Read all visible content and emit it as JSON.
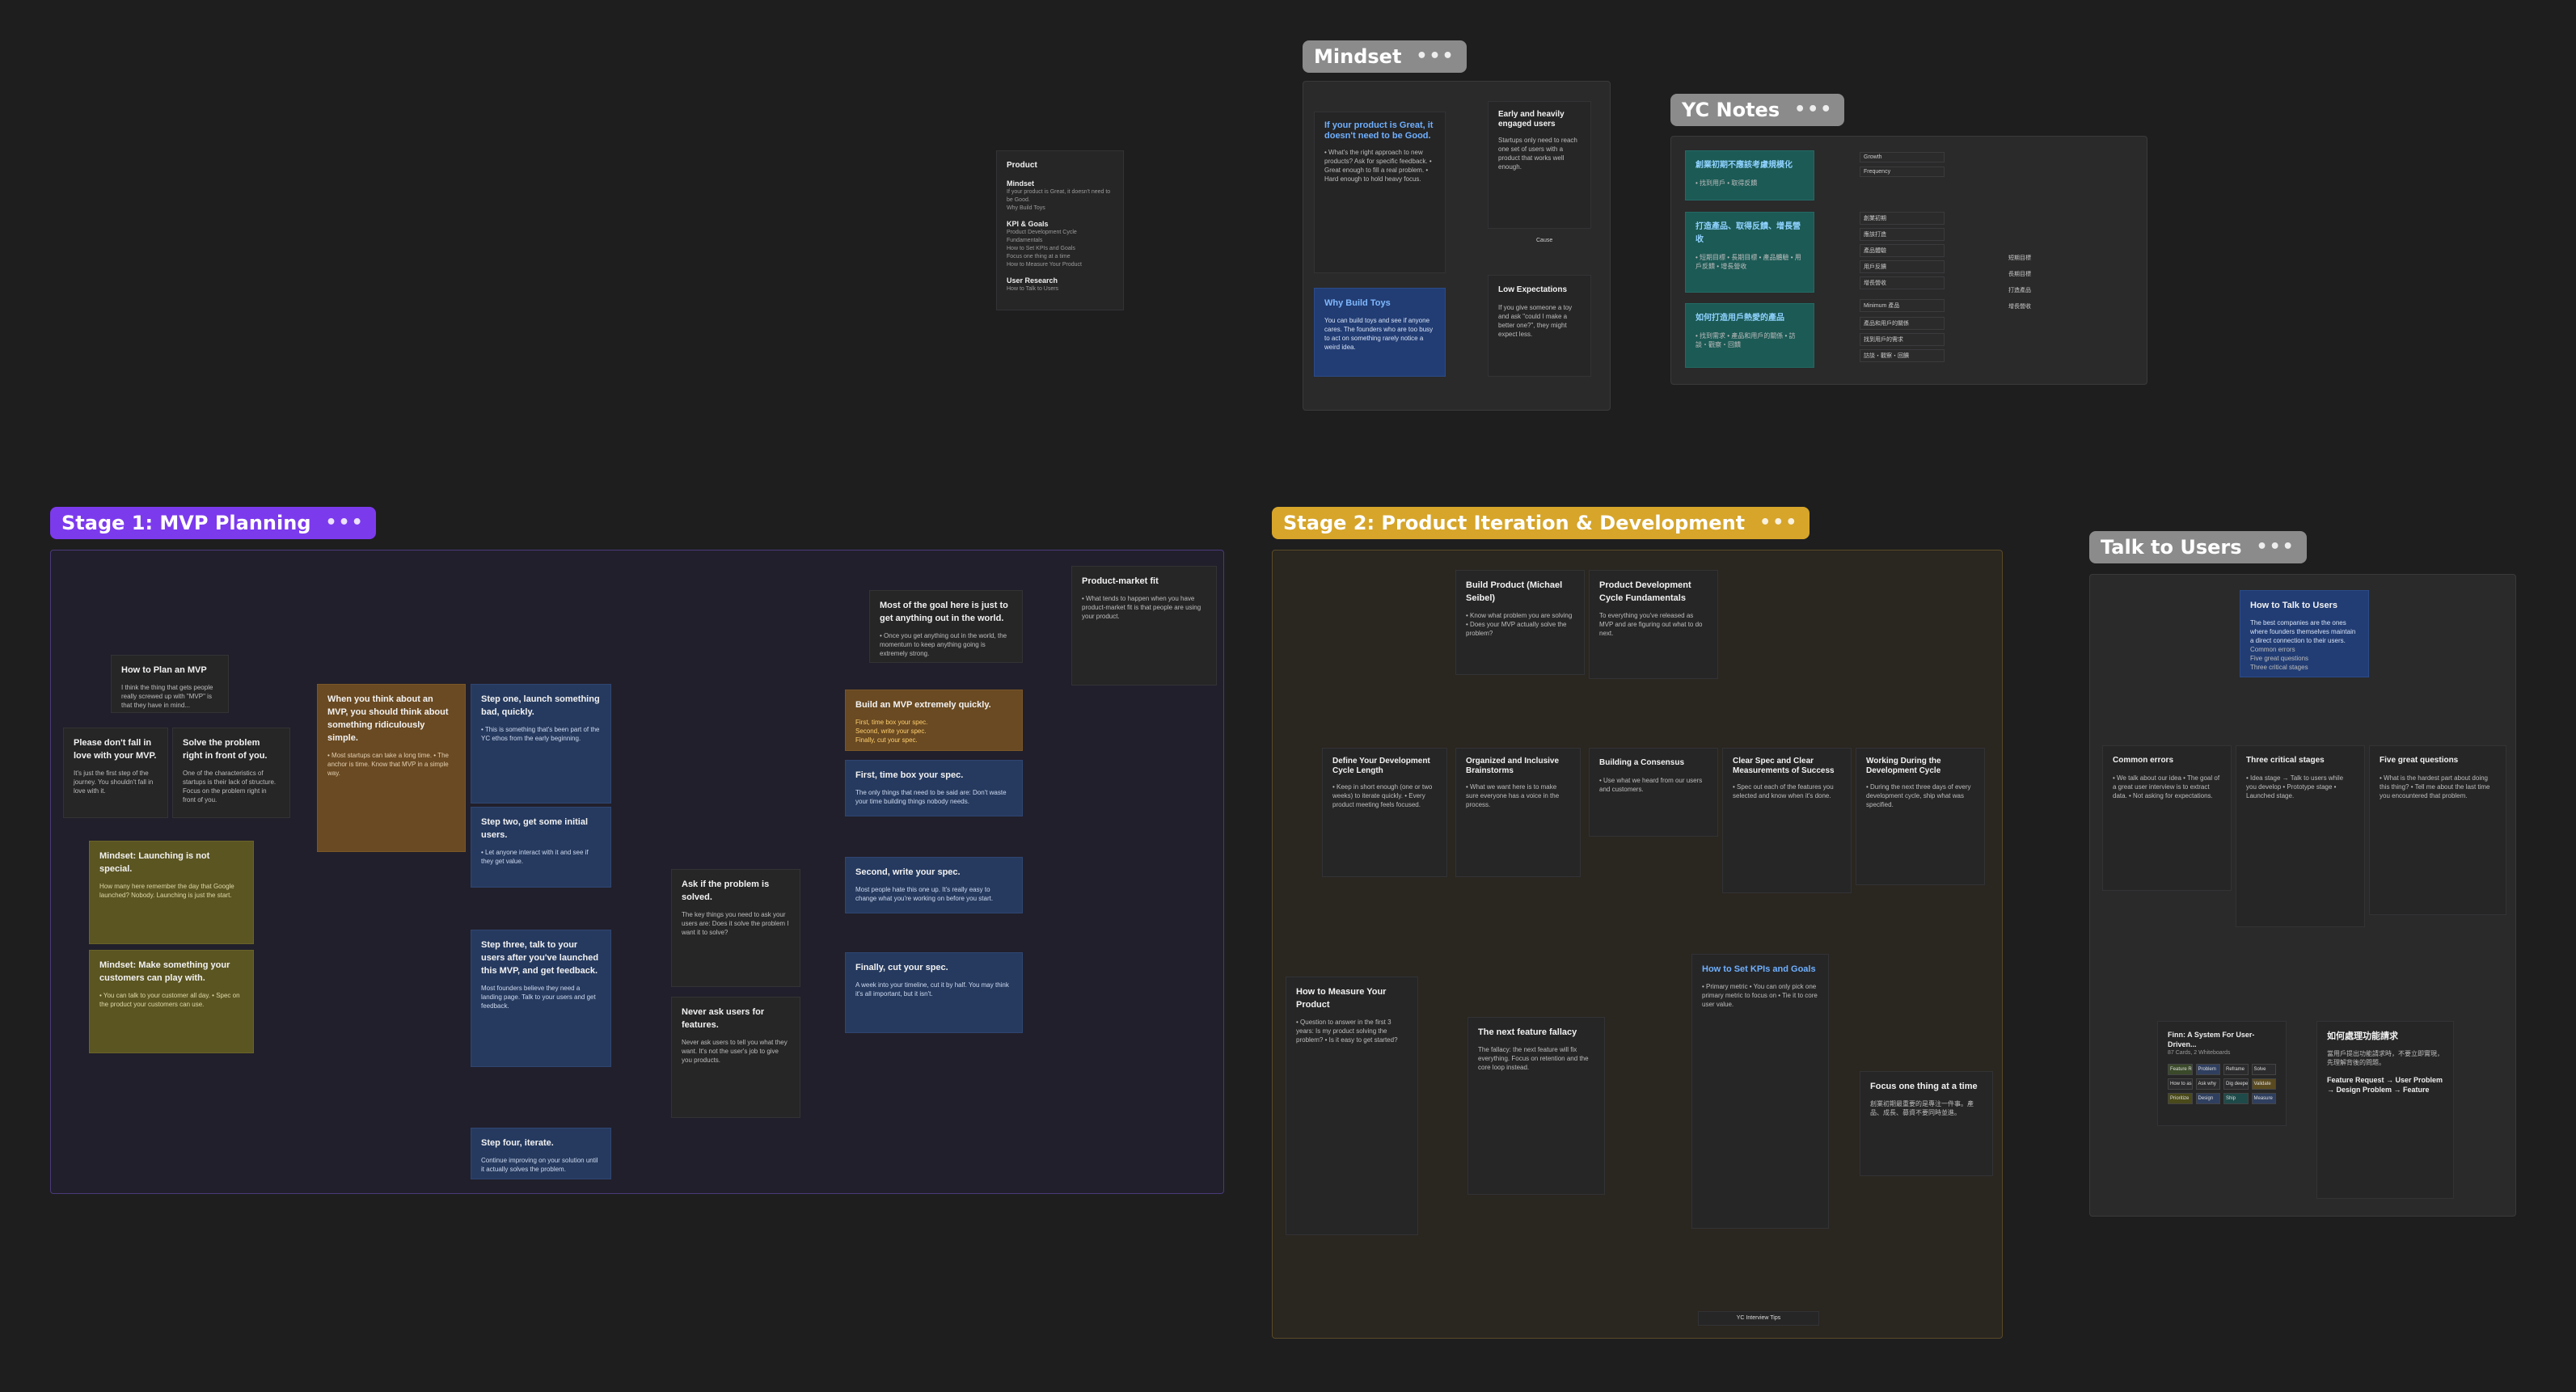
{
  "colors": {
    "canvas": "#1e1e1f",
    "stage1": "#7c3aed",
    "stage2": "#d6a52a",
    "mindset": "#8f8f8f",
    "card": "#262627",
    "blue_card": "#263a5f",
    "olive_card": "#5b5522",
    "brown_card": "#6a4a22"
  },
  "icons": {
    "more": "more-icon"
  },
  "frames": {
    "mindset": {
      "title": "Mindset",
      "more": "•••"
    },
    "yc_notes": {
      "title": "YC Notes",
      "more": "•••"
    },
    "stage1": {
      "title": "Stage 1: MVP Planning",
      "more": "•••"
    },
    "stage2": {
      "title": "Stage 2: Product Iteration & Development",
      "more": "•••"
    },
    "talk": {
      "title": "Talk to Users",
      "more": "•••"
    }
  },
  "outline": {
    "title": "Product",
    "mindset_heading": "Mindset",
    "mindset_items": [
      "If your product is Great, it doesn't need to be Good.",
      "Why Build Toys"
    ],
    "kpi_heading": "KPI & Goals",
    "kpi_items": [
      "Product Development Cycle Fundamentals",
      "How to Set KPIs and Goals",
      "Focus one thing at a time",
      "How to Measure Your Product"
    ],
    "research_heading": "User Research",
    "research_items": [
      "How to Talk to Users"
    ]
  },
  "mindset": {
    "great_title": "If your product is Great, it doesn't need to be Good.",
    "toys_title": "Why Build Toys",
    "early_title": "Early and heavily engaged users",
    "low_title": "Low Expectations",
    "connector": "Cause"
  },
  "yc": {
    "block1": "創業初期不應該考慮規模化",
    "block2": "打造產品、取得反饋、增長營收",
    "block3": "如何打造用戶熱愛的產品",
    "labels": [
      "Growth",
      "Frequency",
      "創業初期",
      "應該打造",
      "產品體驗",
      "用戶反饋",
      "增長營收",
      "Minimum 產品",
      "產品和用戶的關係",
      "找到用戶的需求",
      "訪談・觀察・回饋"
    ],
    "leaves": [
      "短期目標",
      "長期目標",
      "打造產品",
      "增長營收"
    ]
  },
  "stage1": {
    "how_to_plan": "How to Plan an MVP",
    "please_dont": "Please don't fall in love with your MVP.",
    "solve_problem": "Solve the problem right in front of you.",
    "mindset_launch": "Mindset: Launching is not special.",
    "mindset_play": "Mindset: Make something your customers can play with.",
    "ridiculous": "When you think about an MVP, you should think about something ridiculously simple.",
    "step1": "Step one, launch something bad, quickly.",
    "step2": "Step two, get some initial users.",
    "step3": "Step three, talk to your users after you've launched this MVP, and get feedback.",
    "step4": "Step four, iterate.",
    "ask_solved": "Ask if the problem is solved.",
    "never_ask": "Never ask users for features.",
    "goal": "Most of the goal here is just to get anything out in the world.",
    "pmf": "Product-market fit",
    "build_quick": "Build an MVP extremely quickly.",
    "timebox": "First, time box your spec.",
    "write_spec": "Second, write your spec.",
    "cut_spec": "Finally, cut your spec.",
    "build_links": [
      "First, time box your spec.",
      "Second, write your spec.",
      "Finally, cut your spec."
    ]
  },
  "stage2": {
    "build_product": "Build Product (Michael Seibel)",
    "cycle_fund": "Product Development Cycle Fundamentals",
    "define_cycle": "Define Your Development Cycle Length",
    "organized": "Organized and Inclusive Brainstorms",
    "consensus": "Building a Consensus",
    "clear_spec": "Clear Spec and Clear Measurements of Success",
    "working": "Working During the Development Cycle",
    "measure": "How to Measure Your Product",
    "fallacy": "The next feature fallacy",
    "kpis": "How to Set KPIs and Goals",
    "focus": "Focus one thing at a time",
    "interview": "YC Interview Tips"
  },
  "talk": {
    "how_to_talk": "How to Talk to Users",
    "links": [
      "Common errors",
      "Five great questions",
      "Three critical stages"
    ],
    "errors": "Common errors",
    "stages": "Three critical stages",
    "questions": "Five great questions",
    "finn": "Finn: A System For User-Driven...",
    "finn_meta": "87 Cards, 2 Whiteboards",
    "jp_title": "如何處理功能請求",
    "jp_sub": "Feature Request → User Problem → Design Problem → Feature",
    "grid": [
      "Feature Req",
      "Problem",
      "Reframe",
      "Solve",
      "How to ask",
      "Ask why",
      "Dig deeper",
      "Validate",
      "Prioritize",
      "Design",
      "Ship",
      "Measure"
    ]
  }
}
